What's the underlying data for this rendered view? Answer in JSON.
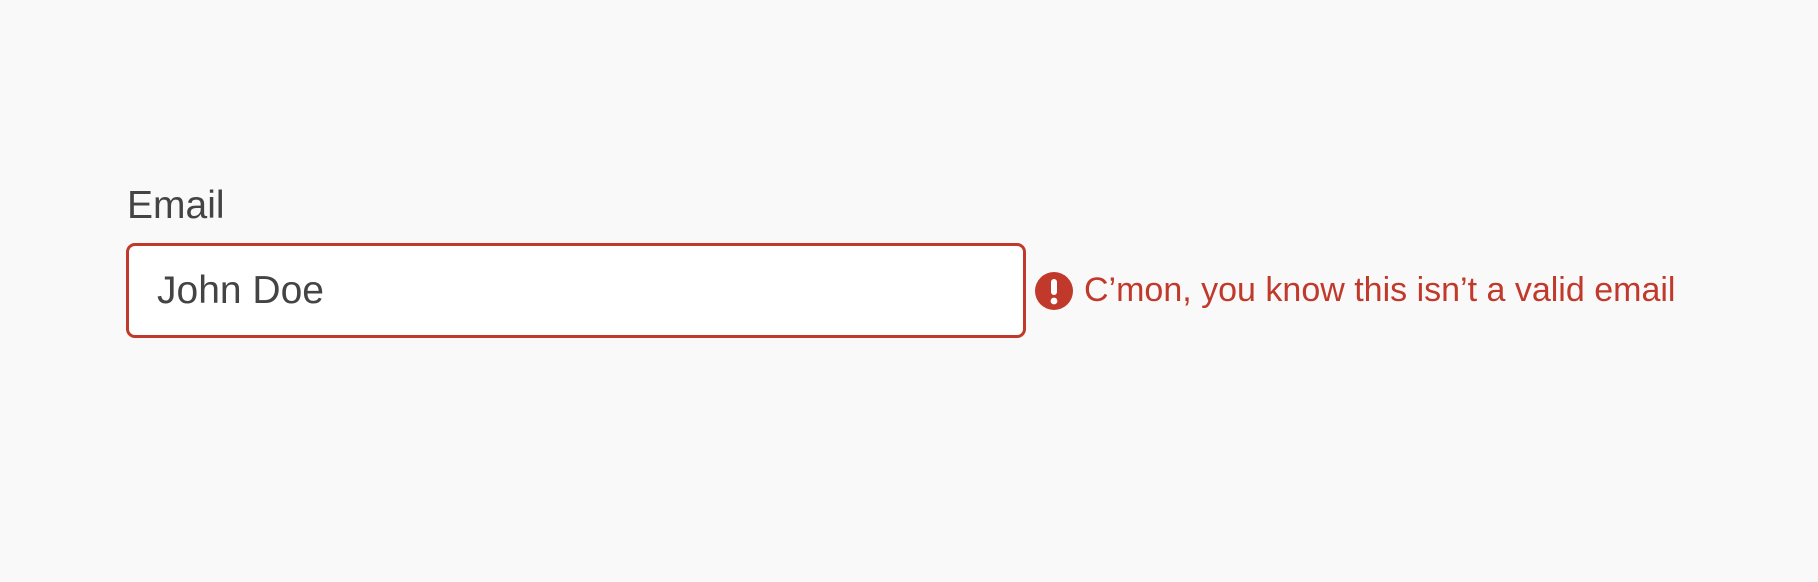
{
  "colors": {
    "background": "#f9f9f9",
    "text": "#444444",
    "error": "#c0392b",
    "input_background": "#ffffff"
  },
  "form": {
    "email": {
      "label": "Email",
      "value": "John Doe",
      "error_icon": "exclamation-circle-icon",
      "error_message": "C’mon, you know this isn’t a valid email"
    }
  }
}
